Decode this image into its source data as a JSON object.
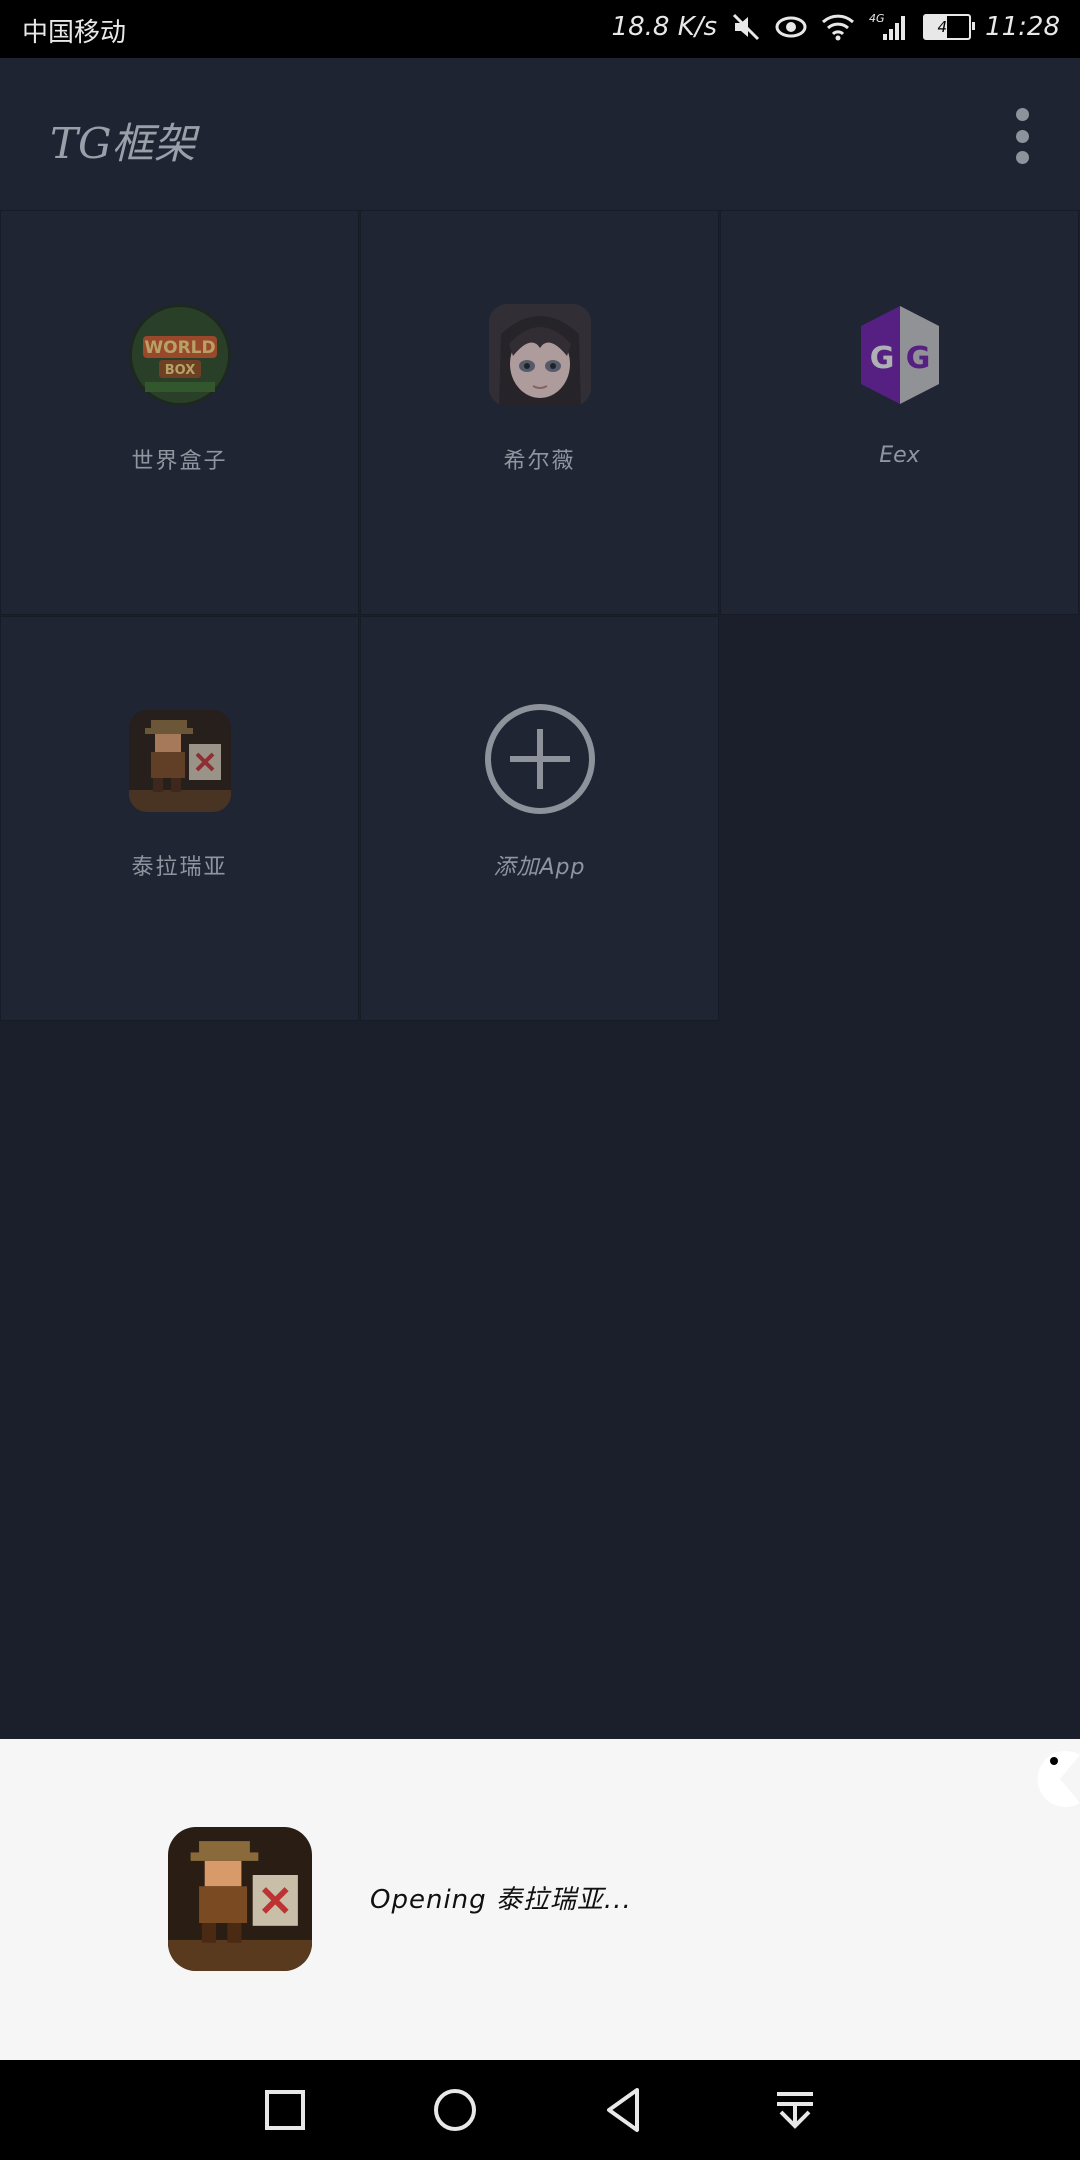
{
  "status_bar": {
    "carrier": "中国移动",
    "net_speed": "18.8 K/s",
    "network_type": "4G",
    "battery": "49",
    "time": "11:28",
    "icons": [
      "mute-icon",
      "eye-icon",
      "wifi-icon",
      "signal-icon",
      "battery-icon"
    ]
  },
  "app_bar": {
    "title": "TG框架",
    "menu_icon": "more-vert-icon"
  },
  "apps": [
    {
      "label": "世界盒子",
      "icon": "worldbox-icon",
      "accent": "#4a7a2a"
    },
    {
      "label": "希尔薇",
      "icon": "sylvie-avatar-icon",
      "accent": "#c9b2b5"
    },
    {
      "label": "Eex",
      "icon": "gameguardian-icon",
      "accent": "#6a1fa0"
    },
    {
      "label": "泰拉瑞亚",
      "icon": "terraria-icon",
      "accent": "#7a4a22"
    }
  ],
  "add_app": {
    "label": "添加App",
    "icon": "add-circle-icon"
  },
  "opening": {
    "text": "Opening 泰拉瑞亚...",
    "icon": "terraria-icon"
  },
  "nav_bar": {
    "icons": [
      "recents-square-icon",
      "home-circle-icon",
      "back-triangle-icon",
      "notification-pull-icon"
    ]
  },
  "colors": {
    "background": "#1a1f2b",
    "tile": "#1f2533",
    "panel": "#f6f6f6",
    "status_bar": "#000000"
  }
}
